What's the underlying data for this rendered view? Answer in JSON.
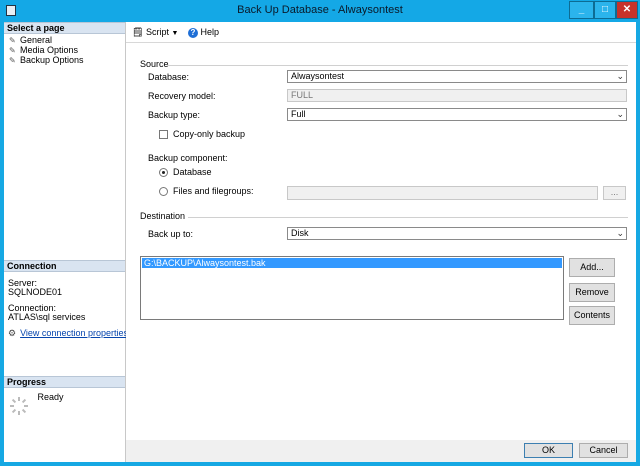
{
  "window": {
    "title": "Back Up Database - Alwaysontest"
  },
  "sidebar": {
    "select_page_header": "Select a page",
    "pages": [
      {
        "label": "General"
      },
      {
        "label": "Media Options"
      },
      {
        "label": "Backup Options"
      }
    ],
    "connection_header": "Connection",
    "server_label": "Server:",
    "server_value": "SQLNODE01",
    "connection_label": "Connection:",
    "connection_value": "ATLAS\\sql services",
    "view_props_link": "View connection properties",
    "progress_header": "Progress",
    "progress_status": "Ready"
  },
  "toolbar": {
    "script_label": "Script",
    "help_label": "Help"
  },
  "source": {
    "section_label": "Source",
    "database_label": "Database:",
    "database_value": "Alwaysontest",
    "recovery_label": "Recovery model:",
    "recovery_value": "FULL",
    "backup_type_label": "Backup type:",
    "backup_type_value": "Full",
    "copy_only_label": "Copy-only backup",
    "copy_only_checked": false,
    "component_label": "Backup component:",
    "component_database": "Database",
    "component_files": "Files and filegroups:",
    "browse_label": "...",
    "selected_component": "Database"
  },
  "destination": {
    "section_label": "Destination",
    "backup_to_label": "Back up to:",
    "backup_to_value": "Disk",
    "paths": [
      "G:\\BACKUP\\Alwaysontest.bak"
    ],
    "add_label": "Add...",
    "remove_label": "Remove",
    "contents_label": "Contents"
  },
  "footer": {
    "ok_label": "OK",
    "cancel_label": "Cancel"
  }
}
